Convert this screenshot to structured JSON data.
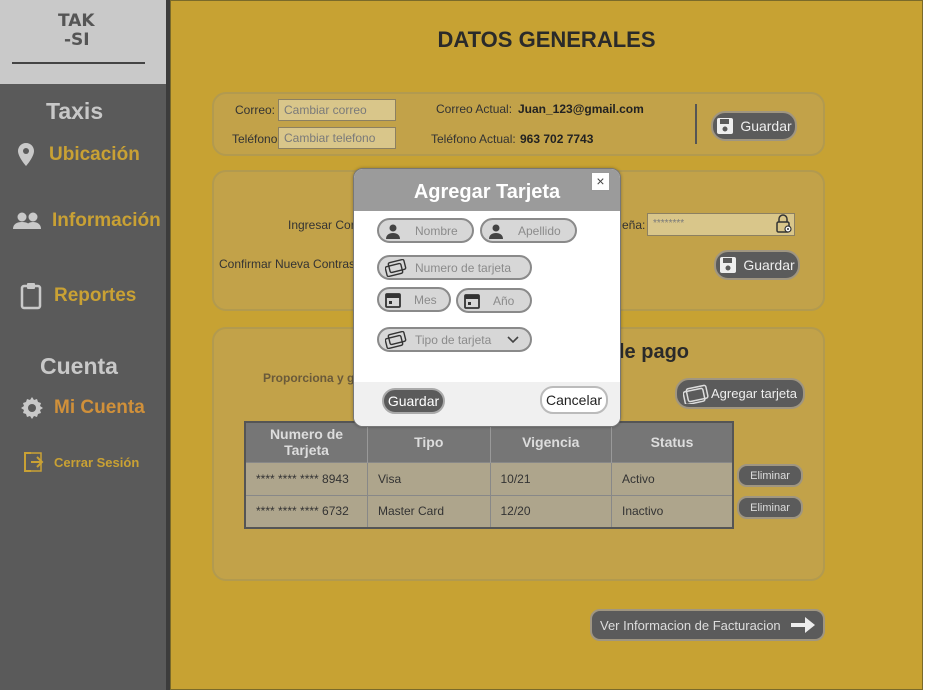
{
  "logo": {
    "line1": "TAK",
    "line2": "-SI"
  },
  "sidebar": {
    "section_taxis": "Taxis",
    "item_ubicacion": "Ubicación",
    "item_informacion": "Información",
    "item_reportes": "Reportes",
    "section_cuenta": "Cuenta",
    "item_mi_cuenta": "Mi Cuenta",
    "item_cerrar_sesion": "Cerrar Sesión"
  },
  "main": {
    "title": "DATOS GENERALES",
    "contact": {
      "correo_label": "Correo:",
      "correo_placeholder": "Cambiar correo",
      "telefono_label": "Teléfono",
      "telefono_placeholder": "Cambiar telefono",
      "correo_actual_label": "Correo Actual:",
      "correo_actual_value": "Juan_123@gmail.com",
      "telefono_actual_label": "Teléfono Actual:",
      "telefono_actual_value": "963 702 7743",
      "save_label": "Guardar"
    },
    "password": {
      "ingresar_label": "Ingresar Cor",
      "confirmar_label": "Confirmar Nueva Contras",
      "right_label": "eña:",
      "masked_value": "********",
      "save_label": "Guardar"
    },
    "payment": {
      "heading_partial": "le pago",
      "description_partial": "Proporciona y g",
      "add_card_label": "Agregar tarjeta",
      "table_headers": [
        "Numero de Tarjeta",
        "Tipo",
        "Vigencia",
        "Status"
      ],
      "rows": [
        {
          "numero": "**** **** **** 8943",
          "tipo": "Visa",
          "vigencia": "10/21",
          "status": "Activo",
          "action": "Eliminar"
        },
        {
          "numero": "**** **** **** 6732",
          "tipo": "Master Card",
          "vigencia": "12/20",
          "status": "Inactivo",
          "action": "Eliminar"
        }
      ]
    },
    "billing_button_label": "Ver Informacion de Facturacion"
  },
  "modal": {
    "title": "Agregar Tarjeta",
    "close": "×",
    "nombre_placeholder": "Nombre",
    "apellido_placeholder": "Apellido",
    "numero_placeholder": "Numero de tarjeta",
    "mes_placeholder": "Mes",
    "anio_placeholder": "Año",
    "tipo_placeholder": "Tipo de tarjeta",
    "save_label": "Guardar",
    "cancel_label": "Cancelar"
  },
  "colors": {
    "main_bg": "#c7a233",
    "sidebar_bg": "#5a5a5a",
    "accent_gold": "#c9a134",
    "button_dark": "#5b5b5b"
  },
  "icons": [
    "taxi-logo",
    "location-pin-icon",
    "people-icon",
    "clipboard-icon",
    "gear-icon",
    "logout-icon",
    "save-icon",
    "lock-eye-icon",
    "credit-card-icon",
    "person-icon",
    "calendar-icon",
    "chevron-down-icon",
    "arrow-right-icon",
    "close-icon"
  ]
}
